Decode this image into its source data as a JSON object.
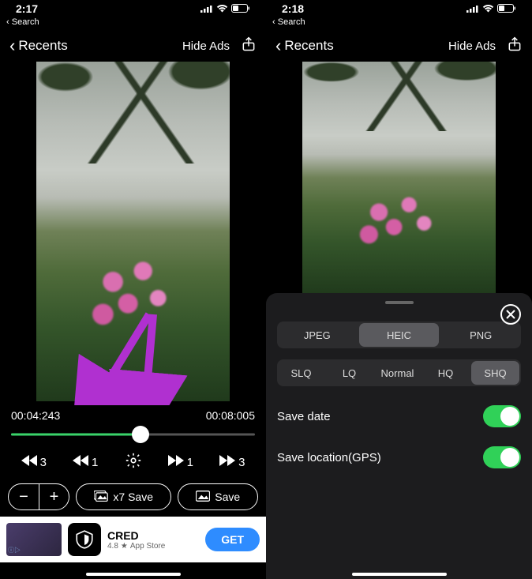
{
  "left": {
    "status_time": "2:17",
    "back_search": "Search",
    "nav_back": "Recents",
    "hide_ads": "Hide Ads",
    "time_current": "00:04:243",
    "time_total": "00:08:005",
    "progress_pct": 53,
    "transport": {
      "rew3": "3",
      "rew1": "1",
      "fwd1": "1",
      "fwd3": "3"
    },
    "minus": "−",
    "plus": "+",
    "x7save": "x7 Save",
    "save": "Save",
    "ad": {
      "title": "CRED",
      "rating": "4.8",
      "store": "App Store",
      "cta": "GET"
    }
  },
  "right": {
    "status_time": "2:18",
    "back_search": "Search",
    "nav_back": "Recents",
    "hide_ads": "Hide Ads",
    "formats": [
      "JPEG",
      "HEIC",
      "PNG"
    ],
    "format_selected": "HEIC",
    "qualities": [
      "SLQ",
      "LQ",
      "Normal",
      "HQ",
      "SHQ"
    ],
    "quality_selected": "SHQ",
    "save_date_label": "Save date",
    "save_loc_label": "Save location(GPS)",
    "save_date_on": true,
    "save_loc_on": true
  }
}
